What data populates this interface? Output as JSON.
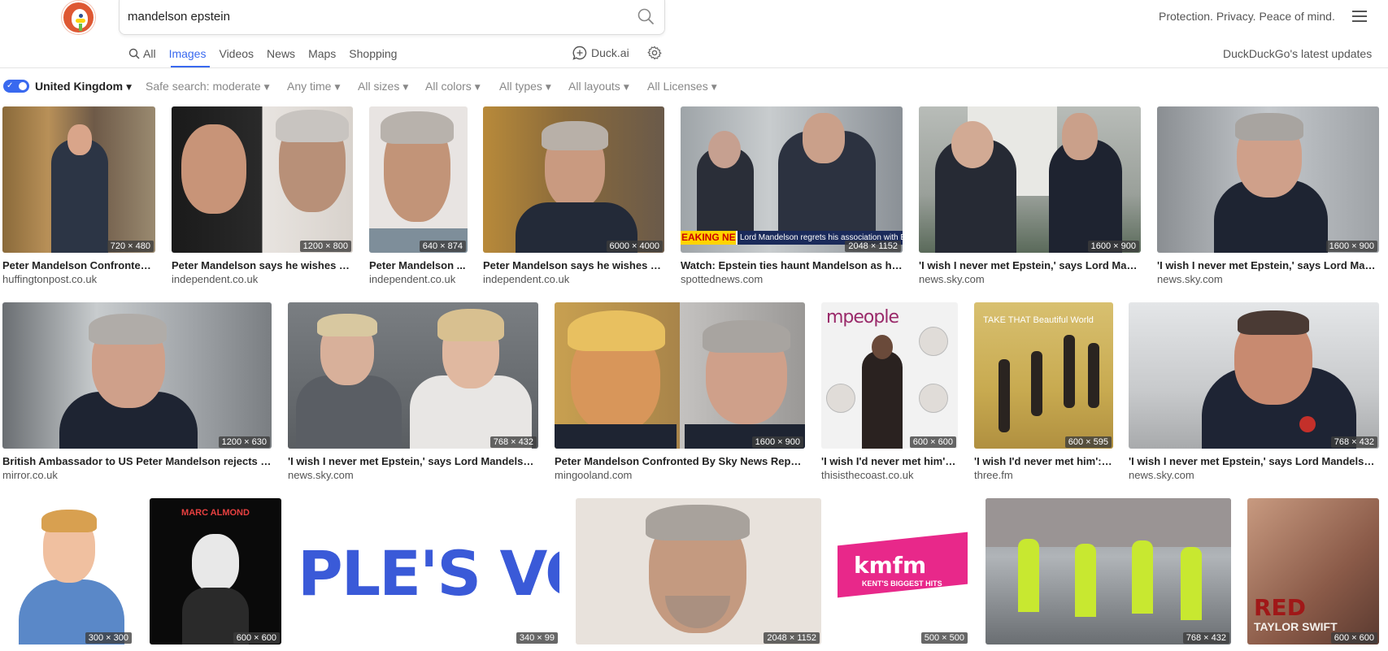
{
  "search": {
    "query": "mandelson epstein"
  },
  "header": {
    "tagline": "Protection. Privacy. Peace of mind.",
    "updates": "DuckDuckGo's latest updates"
  },
  "tabs": [
    {
      "label": "All",
      "icon": "search-icon"
    },
    {
      "label": "Images",
      "active": true
    },
    {
      "label": "Videos"
    },
    {
      "label": "News"
    },
    {
      "label": "Maps"
    },
    {
      "label": "Shopping"
    }
  ],
  "duck_ai": {
    "label": "Duck.ai",
    "icon": "chat-bubble-icon"
  },
  "settings": {
    "icon": "gear-icon"
  },
  "filters": {
    "region": "United Kingdom",
    "region_enabled": true,
    "safe_search": "Safe search: moderate",
    "time": "Any time",
    "size": "All sizes",
    "color": "All colors",
    "type": "All types",
    "layout": "All layouts",
    "license": "All Licenses"
  },
  "accent_color": "#3969ef",
  "results": [
    {
      "title": "Peter Mandelson Confronted ...",
      "source": "huffingtonpost.co.uk",
      "dims": "720 × 480"
    },
    {
      "title": "Peter Mandelson says he wishes he...",
      "source": "independent.co.uk",
      "dims": "1200 × 800"
    },
    {
      "title": "Peter Mandelson ...",
      "source": "independent.co.uk",
      "dims": "640 × 874"
    },
    {
      "title": "Peter Mandelson says he wishes he...",
      "source": "independent.co.uk",
      "dims": "6000 × 4000"
    },
    {
      "title": "Watch: Epstein ties haunt Mandelson as he ...",
      "source": "spottednews.com",
      "dims": "2048 × 1152",
      "caption": "EAKING NEWS",
      "ticker": "Lord Mandelson regrets his association with Ep"
    },
    {
      "title": "'I wish I never met Epstein,' says Lord Mand...",
      "source": "news.sky.com",
      "dims": "1600 × 900"
    },
    {
      "title": "'I wish I never met Epstein,' says Lord Mand...",
      "source": "news.sky.com",
      "dims": "1600 × 900"
    },
    {
      "title": "British Ambassador to US Peter Mandelson rejects Ep...",
      "source": "mirror.co.uk",
      "dims": "1200 × 630"
    },
    {
      "title": "'I wish I never met Epstein,' says Lord Mandelson l...",
      "source": "news.sky.com",
      "dims": "768 × 432"
    },
    {
      "title": "Peter Mandelson Confronted By Sky News Report...",
      "source": "mingooland.com",
      "dims": "1600 × 900"
    },
    {
      "title": "'I wish I'd never met him': ...",
      "source": "thisisthecoast.co.uk",
      "dims": "600 × 600",
      "caption": "mpeople"
    },
    {
      "title": "'I wish I'd never met him': ...",
      "source": "three.fm",
      "dims": "600 × 595",
      "caption": "TAKE THAT Beautiful World"
    },
    {
      "title": "'I wish I never met Epstein,' says Lord Mandelson l...",
      "source": "news.sky.com",
      "dims": "768 × 432"
    },
    {
      "dims": "300 × 300"
    },
    {
      "dims": "600 × 600",
      "caption": "MARC ALMOND"
    },
    {
      "dims": "340 × 99",
      "caption": "PLE'S VOI"
    },
    {
      "dims": "2048 × 1152"
    },
    {
      "dims": "500 × 500",
      "caption": "kmfm",
      "subcaption": "KENT'S BIGGEST HITS"
    },
    {
      "dims": "768 × 432"
    },
    {
      "dims": "600 × 600",
      "caption": "RED",
      "subcaption": "TAYLOR SWIFT"
    }
  ]
}
